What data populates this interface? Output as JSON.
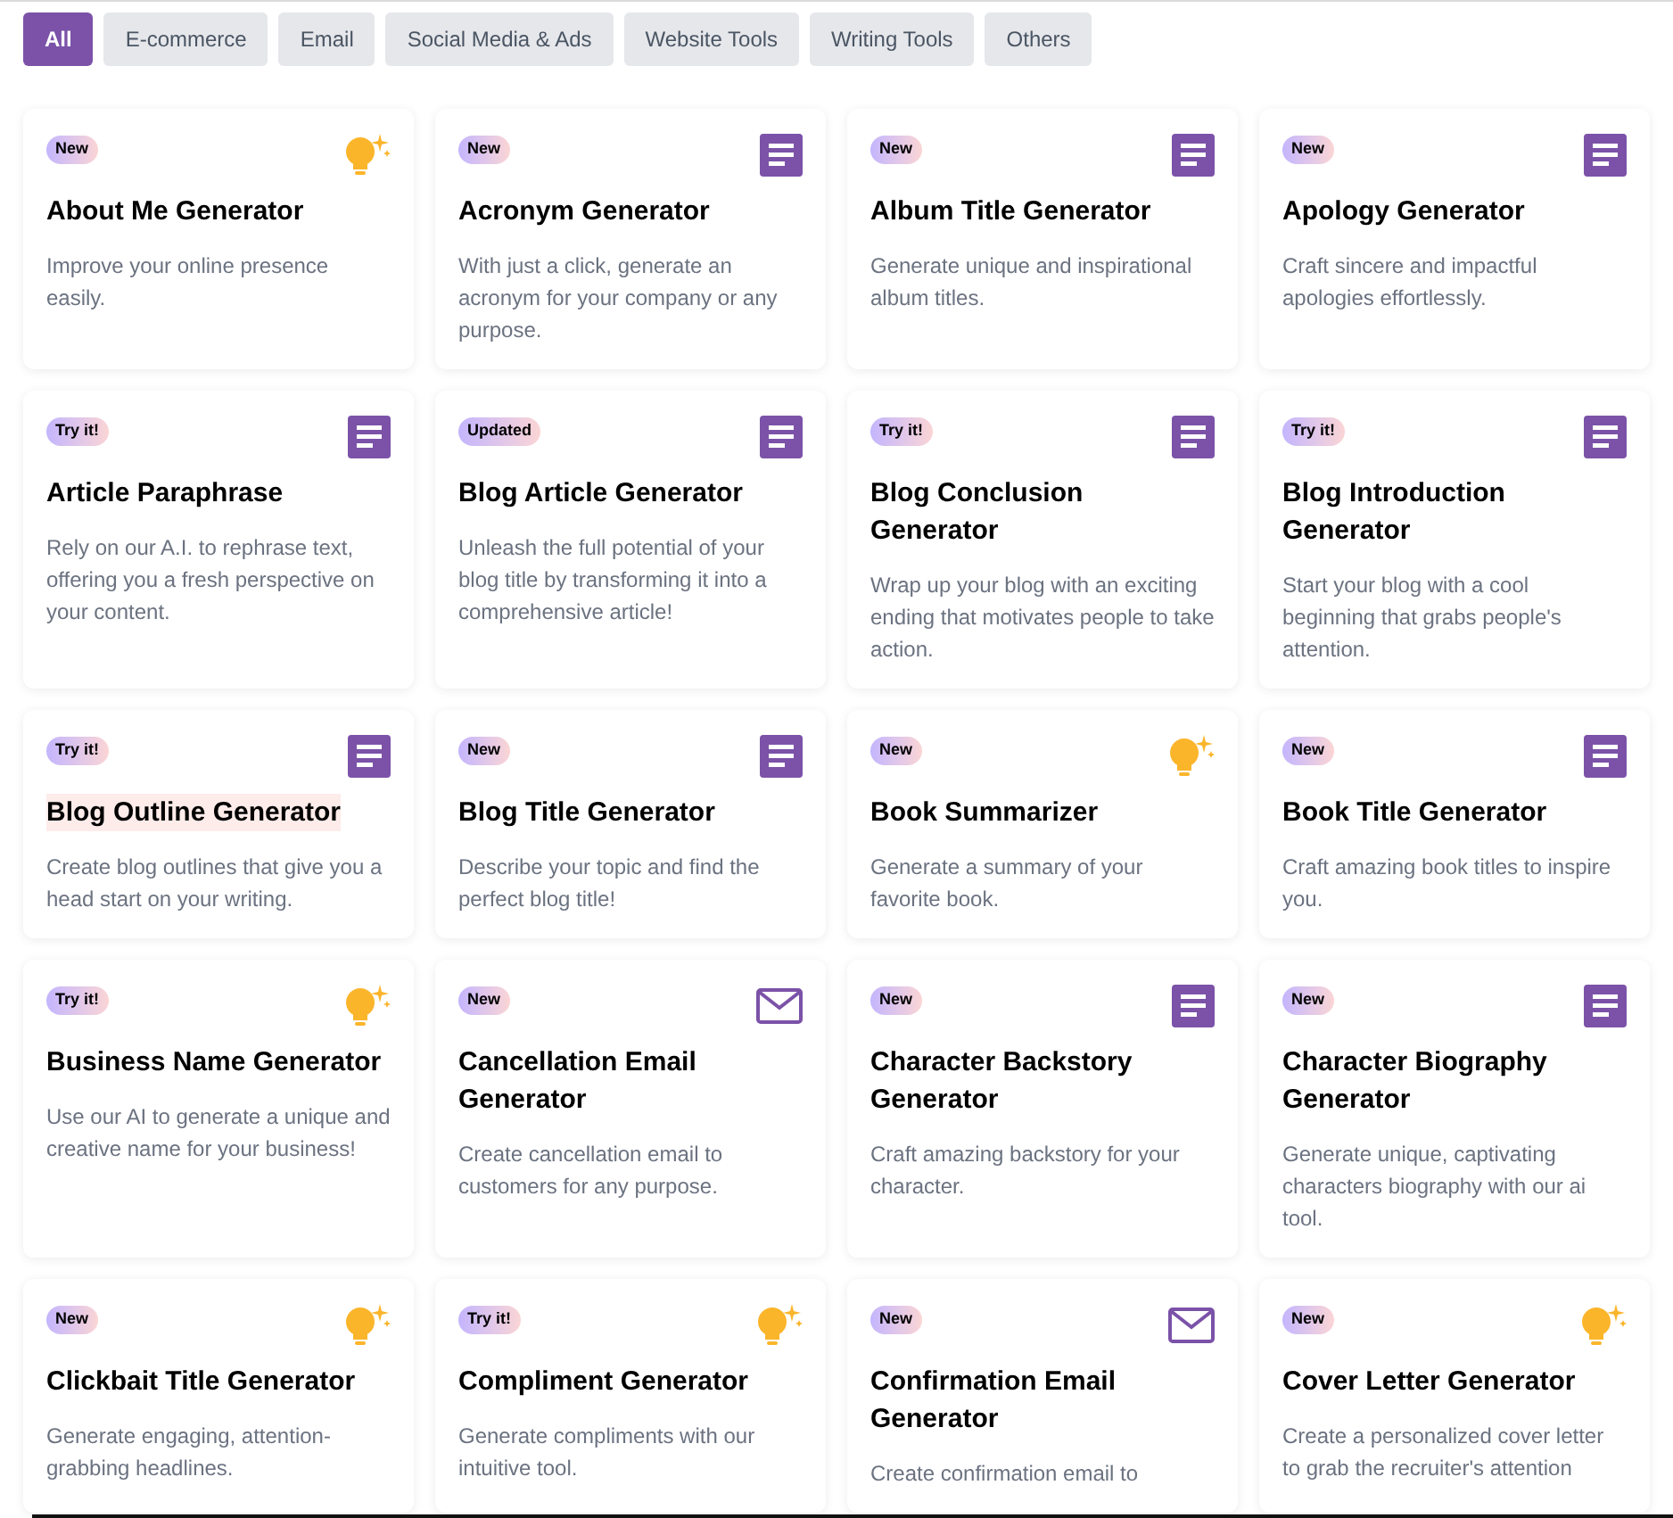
{
  "filters": [
    {
      "label": "All",
      "selected": true
    },
    {
      "label": "E-commerce",
      "selected": false
    },
    {
      "label": "Email",
      "selected": false
    },
    {
      "label": "Social Media & Ads",
      "selected": false
    },
    {
      "label": "Website Tools",
      "selected": false
    },
    {
      "label": "Writing Tools",
      "selected": false
    },
    {
      "label": "Others",
      "selected": false
    }
  ],
  "tools": [
    {
      "badge": "New",
      "kind": "bulb",
      "title": "About Me Generator",
      "description": "Improve your online presence easily.",
      "highlighted": false
    },
    {
      "badge": "New",
      "kind": "document",
      "title": "Acronym Generator",
      "description": "With just a click, generate an acronym for your company or any purpose.",
      "highlighted": false
    },
    {
      "badge": "New",
      "kind": "document",
      "title": "Album Title Generator",
      "description": "Generate unique and inspirational album titles.",
      "highlighted": false
    },
    {
      "badge": "New",
      "kind": "document",
      "title": "Apology Generator",
      "description": "Craft sincere and impactful apologies effortlessly.",
      "highlighted": false
    },
    {
      "badge": "Try it!",
      "kind": "document",
      "title": "Article Paraphrase",
      "description": "Rely on our A.I. to rephrase text, offering you a fresh perspective on your content.",
      "highlighted": false
    },
    {
      "badge": "Updated",
      "kind": "document",
      "title": "Blog Article Generator",
      "description": "Unleash the full potential of your blog title by transforming it into a comprehensive article!",
      "highlighted": false
    },
    {
      "badge": "Try it!",
      "kind": "document",
      "title": "Blog Conclusion Generator",
      "description": "Wrap up your blog with an exciting ending that motivates people to take action.",
      "highlighted": false
    },
    {
      "badge": "Try it!",
      "kind": "document",
      "title": "Blog Introduction Generator",
      "description": "Start your blog with a cool beginning that grabs people's attention.",
      "highlighted": false
    },
    {
      "badge": "Try it!",
      "kind": "document",
      "title": "Blog Outline Generator",
      "description": "Create blog outlines that give you a head start on your writing.",
      "highlighted": true
    },
    {
      "badge": "New",
      "kind": "document",
      "title": "Blog Title Generator",
      "description": "Describe your topic and find the perfect blog title!",
      "highlighted": false
    },
    {
      "badge": "New",
      "kind": "bulb",
      "title": "Book Summarizer",
      "description": "Generate a summary of your favorite book.",
      "highlighted": false
    },
    {
      "badge": "New",
      "kind": "document",
      "title": "Book Title Generator",
      "description": "Craft amazing book titles to inspire you.",
      "highlighted": false
    },
    {
      "badge": "Try it!",
      "kind": "bulb",
      "title": "Business Name Generator",
      "description": "Use our AI to generate a unique and creative name for your business!",
      "highlighted": false
    },
    {
      "badge": "New",
      "kind": "mail",
      "title": "Cancellation Email Generator",
      "description": "Create cancellation email to customers for any purpose.",
      "highlighted": false
    },
    {
      "badge": "New",
      "kind": "document",
      "title": "Character Backstory Generator",
      "description": "Craft amazing backstory for your character.",
      "highlighted": false
    },
    {
      "badge": "New",
      "kind": "document",
      "title": "Character Biography Generator",
      "description": "Generate unique, captivating characters biography with our ai tool.",
      "highlighted": false
    },
    {
      "badge": "New",
      "kind": "bulb",
      "title": "Clickbait Title Generator",
      "description": "Generate engaging, attention-grabbing headlines.",
      "highlighted": false
    },
    {
      "badge": "Try it!",
      "kind": "bulb",
      "title": "Compliment Generator",
      "description": "Generate compliments with our intuitive tool.",
      "highlighted": false
    },
    {
      "badge": "New",
      "kind": "mail",
      "title": "Confirmation Email Generator",
      "description": "Create confirmation email to",
      "highlighted": false
    },
    {
      "badge": "New",
      "kind": "bulb",
      "title": "Cover Letter Generator",
      "description": "Create a personalized cover letter to grab the recruiter's attention",
      "highlighted": false
    }
  ]
}
